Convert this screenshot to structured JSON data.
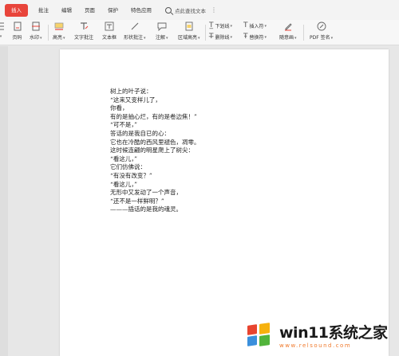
{
  "menu": {
    "tabs": [
      {
        "label": "插入",
        "active": true
      },
      {
        "label": "批注"
      },
      {
        "label": "编辑"
      },
      {
        "label": "页面"
      },
      {
        "label": "保护"
      },
      {
        "label": "特色应用"
      }
    ],
    "search_label": "点此查找文本",
    "more_icon": "more-vertical-icon",
    "accent_color": "#e8443a"
  },
  "ribbon": {
    "page_number": "页码",
    "watermark": "水印",
    "highlight": "高亮",
    "text_comment": "文字批注",
    "textbox": "文本框",
    "shape_comment": "形状批注",
    "note": "注解",
    "area_highlight": "区域高亮",
    "underline": "下划线",
    "strikethrough": "删除线",
    "insert_symbol": "插入符",
    "replace_symbol": "替换符",
    "free_draw": "随意画",
    "pdf_sign": "PDF 签名"
  },
  "document": {
    "lines": [
      "树上的叶子说：",
      "“这来又变样儿了，",
      "你看，",
      "有的是抽心烂，有的是卷边焦！”",
      "“可不是，”",
      "答话的是我自已的心：",
      "它也在冷酷的西风里褪色，凋零。",
      "这时候连翩的明星爬上了树尖：",
      "“看这儿，”",
      "它们仿佛说：",
      "“有没有改变？”",
      "“看这儿，”",
      "无形中又发动了一个声音，",
      "“还不是一样鲜明？”",
      "———插话的是我的魂灵。"
    ]
  },
  "watermark_logo": {
    "title": "win11系统之家",
    "url": "www.relsound.com",
    "colors": [
      "#e8442f",
      "#f6b10d",
      "#3a8fdc",
      "#51b43b"
    ]
  }
}
